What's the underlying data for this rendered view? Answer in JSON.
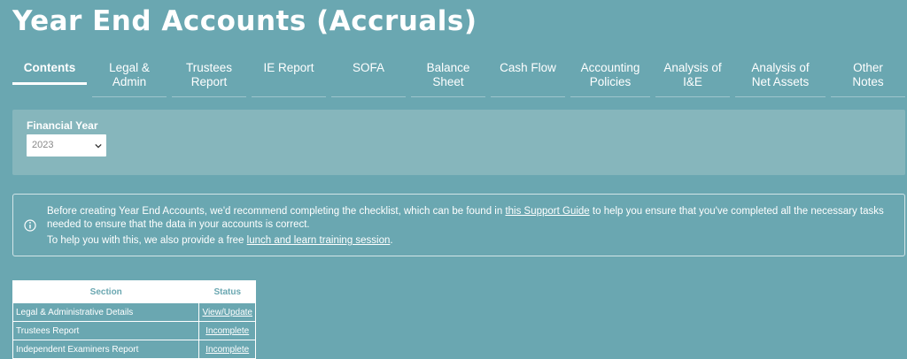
{
  "page": {
    "title": "Year End Accounts (Accruals)"
  },
  "tabs": [
    {
      "line1": "Contents",
      "line2": ""
    },
    {
      "line1": "Legal &",
      "line2": "Admin"
    },
    {
      "line1": "Trustees",
      "line2": "Report"
    },
    {
      "line1": "IE Report",
      "line2": ""
    },
    {
      "line1": "SOFA",
      "line2": ""
    },
    {
      "line1": "Balance",
      "line2": "Sheet"
    },
    {
      "line1": "Cash Flow",
      "line2": ""
    },
    {
      "line1": "Accounting",
      "line2": "Policies"
    },
    {
      "line1": "Analysis of",
      "line2": "I&E"
    },
    {
      "line1": "Analysis of",
      "line2": "Net Assets"
    },
    {
      "line1": "Other",
      "line2": "Notes"
    }
  ],
  "financial_year": {
    "label": "Financial Year",
    "value": "2023"
  },
  "notice": {
    "line1_before": "Before creating Year End Accounts, we'd recommend completing the checklist, which can be found in ",
    "line1_link": "this Support Guide",
    "line1_after": " to help you ensure that you've completed all the necessary tasks",
    "line2": "needed to ensure that the data in your accounts is correct.",
    "line3_before": "To help you with this, we also provide a free ",
    "line3_link": "lunch and learn training session",
    "line3_after": "."
  },
  "table": {
    "headers": {
      "section": "Section",
      "status": "Status"
    },
    "rows": [
      {
        "section": "Legal & Administrative Details",
        "status": "View/Update"
      },
      {
        "section": "Trustees Report",
        "status": "Incomplete"
      },
      {
        "section": "Independent Examiners Report",
        "status": "Incomplete"
      }
    ]
  },
  "colors": {
    "background": "#6aa7b1",
    "panel": "#86b6bc",
    "text": "#ffffff"
  },
  "icons": {
    "select": "chevron-down-icon",
    "notice": "info-icon"
  }
}
